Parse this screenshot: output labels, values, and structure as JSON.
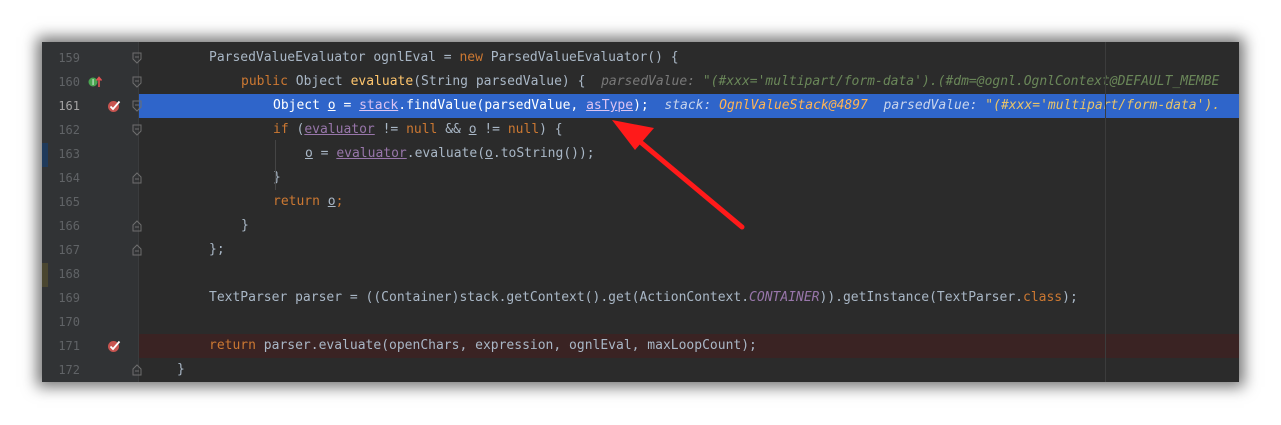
{
  "editor": {
    "lines": [
      {
        "number": "159",
        "code": [
          "ParsedValueEvaluator ognlEval = ",
          "new",
          " ParsedValueEvaluator() {"
        ]
      },
      {
        "number": "160",
        "code": [
          "public",
          " Object ",
          "evaluate",
          "(String parsedValue) {"
        ],
        "hint": {
          "label": "parsedValue: ",
          "value": "\"(#xxx='multipart/form-data').(#dm=@ognl.OgnlContext@DEFAULT_MEMBE"
        }
      },
      {
        "number": "161",
        "code": [
          "Object ",
          "o",
          " = ",
          "stack",
          ".findValue(parsedValue, ",
          "asType",
          ");"
        ],
        "hint1": {
          "label": "stack: ",
          "value": "OgnlValueStack@4897"
        },
        "hint2": {
          "label": "parsedValue: ",
          "value": "\"(#xxx='multipart/form-data')."
        }
      },
      {
        "number": "162",
        "code": [
          "if",
          " (",
          "evaluator",
          " != ",
          "null",
          " && ",
          "o",
          " != ",
          "null",
          ") {"
        ]
      },
      {
        "number": "163",
        "code": [
          "o",
          " = ",
          "evaluator",
          ".evaluate(",
          "o",
          ".toString());"
        ]
      },
      {
        "number": "164",
        "code": [
          "}"
        ]
      },
      {
        "number": "165",
        "code": [
          "return",
          " ",
          "o",
          ";"
        ]
      },
      {
        "number": "166",
        "code": [
          "}"
        ]
      },
      {
        "number": "167",
        "code": [
          "};"
        ]
      },
      {
        "number": "168",
        "code": [
          ""
        ]
      },
      {
        "number": "169",
        "code": [
          "TextParser parser = ((Container)stack.getContext().get(ActionContext.",
          "CONTAINER",
          ")).getInstance(TextParser.",
          "class",
          ");"
        ]
      },
      {
        "number": "170",
        "code": [
          ""
        ]
      },
      {
        "number": "171",
        "code": [
          "return",
          " parser.evaluate(openChars, expression, ognlEval, maxLoopCount);"
        ]
      },
      {
        "number": "172",
        "code": [
          "}"
        ]
      }
    ]
  },
  "colors": {
    "background": "#2b2b2b",
    "gutter": "#313335",
    "current_line": "#2f65ca",
    "breakpoint_line": "#3a2323",
    "keyword": "#cc7832",
    "method": "#ffc66d",
    "field": "#9876aa",
    "arrow": "#ff1a1a"
  },
  "icons": {
    "line_160": "override-method-icon",
    "line_161": "breakpoint-check-icon",
    "line_171": "breakpoint-check-icon",
    "annotation": "red-arrow-icon"
  }
}
